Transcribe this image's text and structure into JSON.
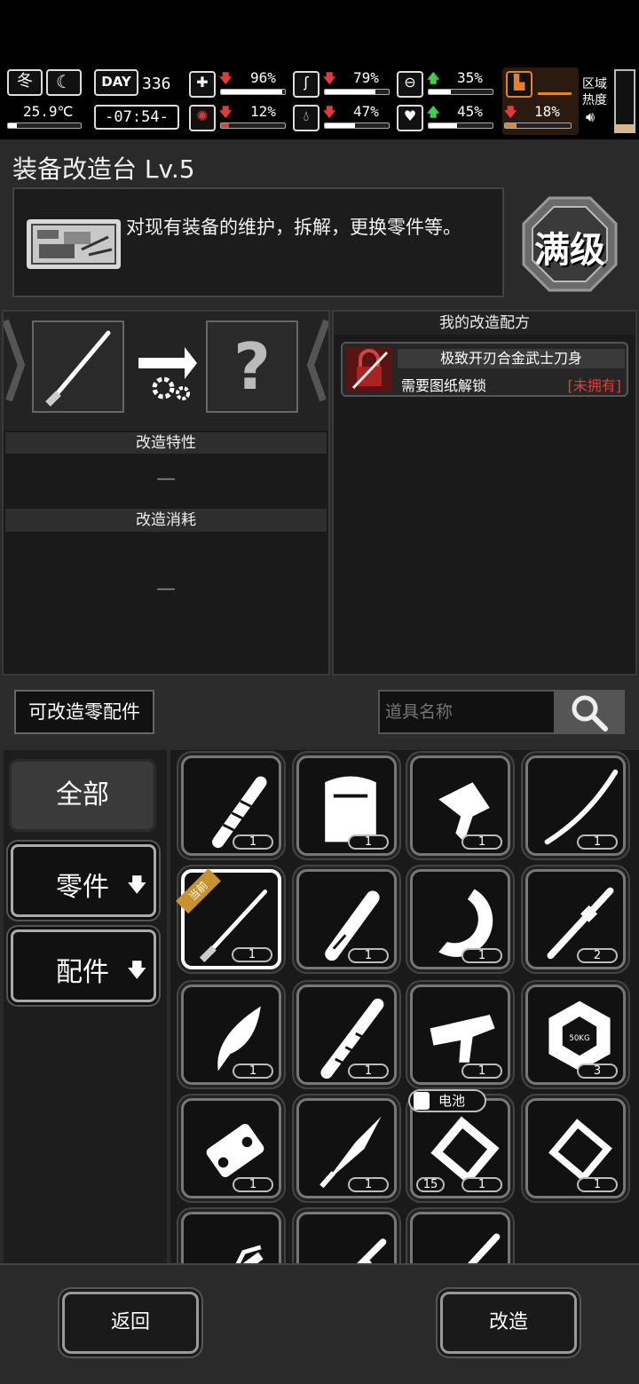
{
  "status": {
    "season": "冬",
    "temperature": "25.9℃",
    "day_label": "DAY",
    "day": "336",
    "time": "-07:54-",
    "health": "96%",
    "hunger": "79%",
    "stamina": "35%",
    "injury": "12%",
    "thirst": "47%",
    "mood": "45%",
    "weight": "18%",
    "region_label_1": "区域",
    "region_label_2": "热度",
    "levels": {
      "health": 0.96,
      "hunger": 0.79,
      "stamina": 0.35,
      "injury": 0.12,
      "thirst": 0.47,
      "mood": 0.45,
      "weight": 0.18
    }
  },
  "station": {
    "title": "装备改造台 Lv.5",
    "description": "对现有装备的维护，拆解，更换零件等。",
    "badge": "满级"
  },
  "modify": {
    "result_placeholder": "?",
    "traits_header": "改造特性",
    "traits_value": "—",
    "cost_header": "改造消耗",
    "cost_value": "—"
  },
  "recipes": {
    "header": "我的改造配方",
    "items": [
      {
        "name": "极致开刃合金武士刀身",
        "requirement": "需要图纸解锁",
        "status": "[未拥有]"
      }
    ]
  },
  "parts": {
    "section_label": "可改造零配件",
    "search_placeholder": "道具名称"
  },
  "filters": {
    "all": "全部",
    "parts": "零件",
    "accessories": "配件",
    "arrow": "🡇"
  },
  "grid": {
    "current_tag": "当前",
    "battery_tag": "电池",
    "items": [
      {
        "icon": "handle-icon",
        "count": "1"
      },
      {
        "icon": "vest-icon",
        "count": "1"
      },
      {
        "icon": "axe-head-icon",
        "count": "1"
      },
      {
        "icon": "katana-blade-icon",
        "count": "1"
      },
      {
        "icon": "katana-current-icon",
        "count": "1"
      },
      {
        "icon": "grip-icon",
        "count": "1"
      },
      {
        "icon": "saw-blade-icon",
        "count": "1"
      },
      {
        "icon": "rod-icon",
        "count": "2"
      },
      {
        "icon": "claw-blade-icon",
        "count": "1"
      },
      {
        "icon": "wrapped-handle-icon",
        "count": "1"
      },
      {
        "icon": "gun-frame-icon",
        "count": "1"
      },
      {
        "icon": "weight-plate-icon",
        "count": "3"
      },
      {
        "icon": "motor-icon",
        "count": "1"
      },
      {
        "icon": "spearhead-icon",
        "count": "1"
      },
      {
        "icon": "battery-pack-icon",
        "count": "1",
        "extra": "15"
      },
      {
        "icon": "battery-cell-icon",
        "count": "1"
      },
      {
        "icon": "scope-icon",
        "count": ""
      },
      {
        "icon": "barrel-icon",
        "count": ""
      },
      {
        "icon": "stick-icon",
        "count": ""
      }
    ]
  },
  "footer": {
    "back": "返回",
    "modify": "改造"
  }
}
